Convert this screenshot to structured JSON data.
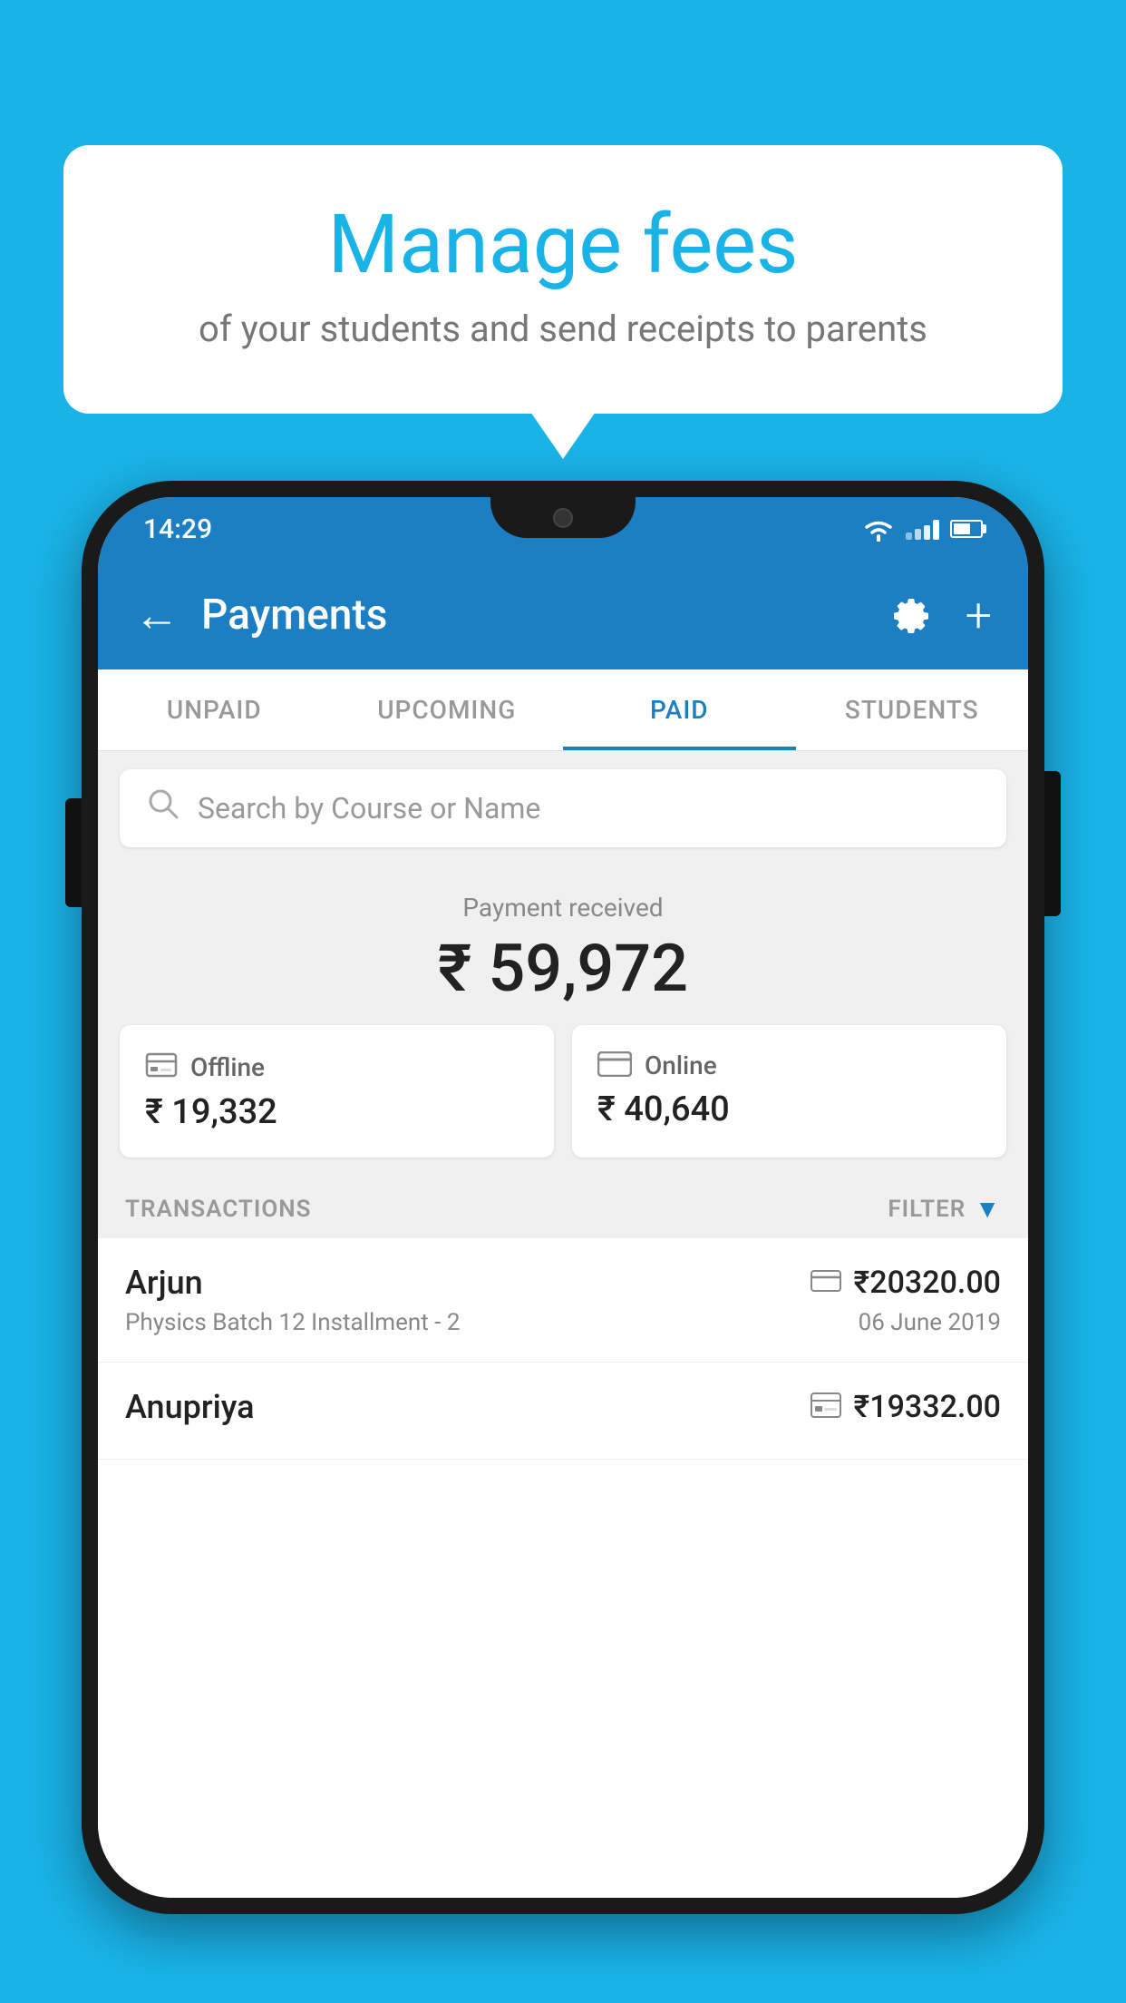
{
  "background_color": "#1ab3e8",
  "speech_bubble": {
    "title": "Manage fees",
    "subtitle": "of your students and send receipts to parents"
  },
  "status_bar": {
    "time": "14:29"
  },
  "app_bar": {
    "title": "Payments",
    "back_label": "←",
    "plus_label": "+"
  },
  "tabs": [
    {
      "label": "UNPAID",
      "active": false
    },
    {
      "label": "UPCOMING",
      "active": false
    },
    {
      "label": "PAID",
      "active": true
    },
    {
      "label": "STUDENTS",
      "active": false
    }
  ],
  "search": {
    "placeholder": "Search by Course or Name"
  },
  "payment_received": {
    "label": "Payment received",
    "amount": "₹ 59,972"
  },
  "payment_cards": [
    {
      "icon_name": "offline-icon",
      "label": "Offline",
      "amount": "₹ 19,332"
    },
    {
      "icon_name": "online-icon",
      "label": "Online",
      "amount": "₹ 40,640"
    }
  ],
  "transactions_section": {
    "label": "TRANSACTIONS",
    "filter_label": "FILTER"
  },
  "transactions": [
    {
      "name": "Arjun",
      "payment_type": "online",
      "amount": "₹20320.00",
      "description": "Physics Batch 12 Installment - 2",
      "date": "06 June 2019"
    },
    {
      "name": "Anupriya",
      "payment_type": "offline",
      "amount": "₹19332.00",
      "description": "",
      "date": ""
    }
  ]
}
